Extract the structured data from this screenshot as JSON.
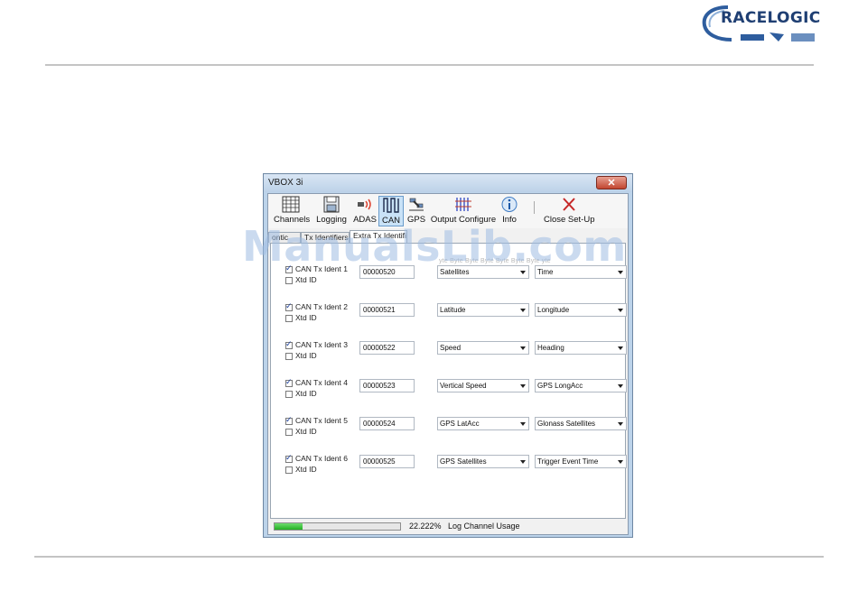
{
  "brand": {
    "logo_text": "RACELOGIC",
    "accent": "#1f3f73"
  },
  "window": {
    "title": "VBOX 3i",
    "close_glyph": "✕"
  },
  "toolbar": [
    {
      "label": "Channels",
      "icon": "grid-icon"
    },
    {
      "label": "Logging",
      "icon": "floppy-disk-icon"
    },
    {
      "label": "ADAS",
      "icon": "radar-icon"
    },
    {
      "label": "CAN",
      "icon": "can-signal-icon",
      "active": true
    },
    {
      "label": "GPS",
      "icon": "satellite-icon"
    },
    {
      "label": "Output Configure",
      "icon": "output-config-icon"
    },
    {
      "label": "Info",
      "icon": "info-icon"
    },
    {
      "label": "Close Set-Up",
      "icon": "close-x-icon"
    }
  ],
  "tabs": [
    {
      "label": "ontic"
    },
    {
      "label": "Tx Identifiers"
    },
    {
      "label": "Extra Tx Identifie",
      "active": true
    }
  ],
  "column_headers": "yte  Byte  Byte  Byte  Byte  Byte  Byte  yte",
  "rows": [
    {
      "label": "CAN Tx Ident 1",
      "xtd_label": "Xtd ID",
      "checked": true,
      "xtd": false,
      "id": "00000520",
      "byte1": "Satellites",
      "byte2": "Time"
    },
    {
      "label": "CAN Tx Ident 2",
      "xtd_label": "Xtd ID",
      "checked": true,
      "xtd": false,
      "id": "00000521",
      "byte1": "Latitude",
      "byte2": "Longitude"
    },
    {
      "label": "CAN Tx Ident 3",
      "xtd_label": "Xtd ID",
      "checked": true,
      "xtd": false,
      "id": "00000522",
      "byte1": "Speed",
      "byte2": "Heading"
    },
    {
      "label": "CAN Tx Ident 4",
      "xtd_label": "Xtd ID",
      "checked": true,
      "xtd": false,
      "id": "00000523",
      "byte1": "Vertical Speed",
      "byte2": "GPS LongAcc"
    },
    {
      "label": "CAN Tx Ident 5",
      "xtd_label": "Xtd ID",
      "checked": true,
      "xtd": false,
      "id": "00000524",
      "byte1": "GPS LatAcc",
      "byte2": "Glonass Satellites"
    },
    {
      "label": "CAN Tx Ident 6",
      "xtd_label": "Xtd ID",
      "checked": true,
      "xtd": false,
      "id": "00000525",
      "byte1": "GPS Satellites",
      "byte2": "Trigger Event Time"
    }
  ],
  "status": {
    "progress_fraction": 0.22222,
    "percent_text": "22.222%",
    "usage_label": "Log Channel Usage"
  },
  "watermark": "ManualsLib.com"
}
